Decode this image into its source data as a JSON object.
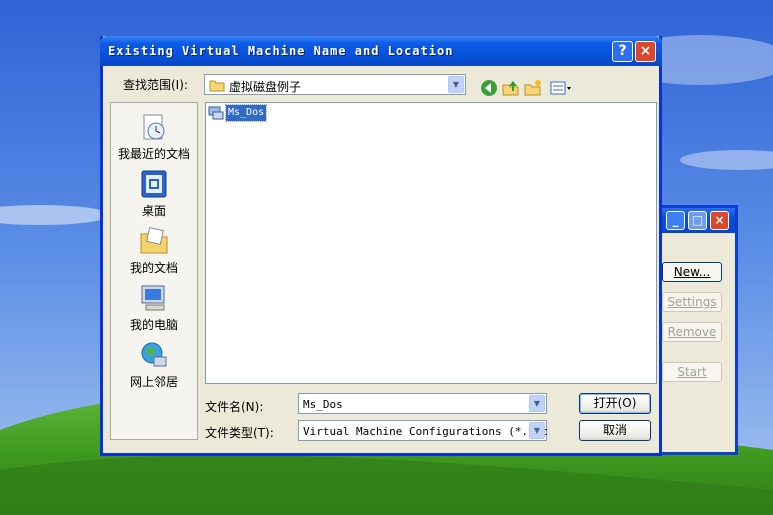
{
  "dialog": {
    "title": "Existing Virtual Machine Name and Location",
    "look_in_label": "查找范围(I):",
    "look_in_value": "虚拟磁盘例子",
    "file_name_label": "文件名(N):",
    "file_name_value": "Ms_Dos",
    "file_type_label": "文件类型(T):",
    "file_type_value": "Virtual Machine Configurations (*.vmc",
    "open_button": "打开(O)",
    "cancel_button": "取消",
    "help_button": "?",
    "close_button": "×"
  },
  "places": [
    {
      "label": "我最近的文档",
      "icon": "recent-documents-icon"
    },
    {
      "label": "桌面",
      "icon": "desktop-icon"
    },
    {
      "label": "我的文档",
      "icon": "my-documents-icon"
    },
    {
      "label": "我的电脑",
      "icon": "my-computer-icon"
    },
    {
      "label": "网上邻居",
      "icon": "network-places-icon"
    }
  ],
  "files": [
    {
      "name": "Ms_Dos",
      "icon": "virtual-machine-icon",
      "selected": true
    }
  ],
  "background_window": {
    "buttons": [
      "New...",
      "Settings",
      "Remove",
      "Start"
    ]
  },
  "colors": {
    "title_blue": "#0a4fd8",
    "selection": "#316ac5",
    "dialog_face": "#ece9d8"
  }
}
